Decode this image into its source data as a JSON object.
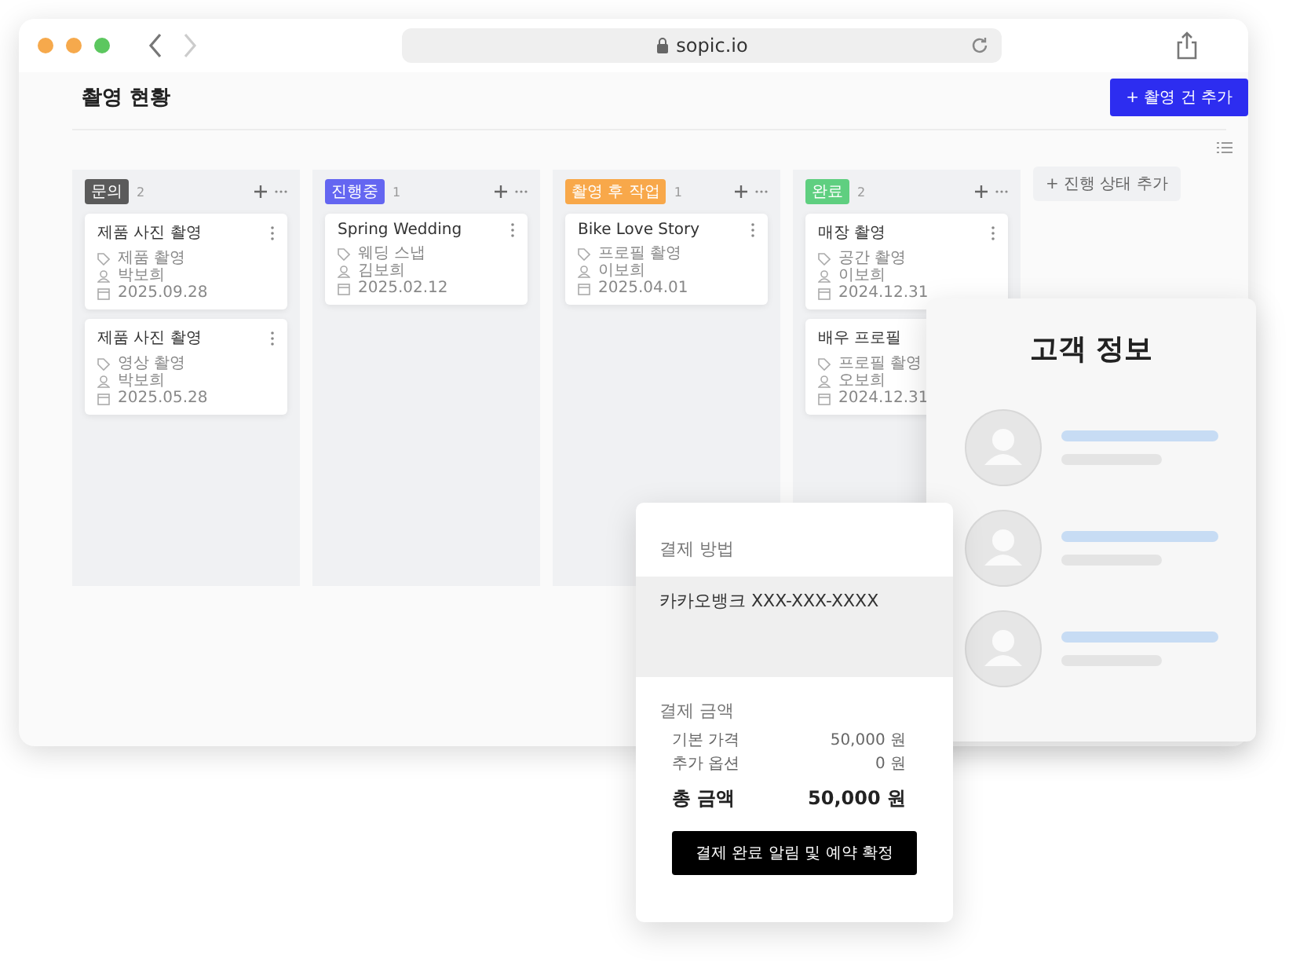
{
  "browser": {
    "url": "sopic.io"
  },
  "page": {
    "title": "촬영 현황",
    "add_button": "+ 촬영 건 추가",
    "add_status_button": "+ 진행 상태 추가"
  },
  "columns": [
    {
      "label": "문의",
      "color": "#5b5b5b",
      "count": "2",
      "cards": [
        {
          "title": "제품 사진 촬영",
          "type": "제품 촬영",
          "person": "박보희",
          "date": "2025.09.28"
        },
        {
          "title": "제품 사진 촬영",
          "type": "영상 촬영",
          "person": "박보희",
          "date": "2025.05.28"
        }
      ]
    },
    {
      "label": "진행중",
      "color": "#6466f1",
      "count": "1",
      "cards": [
        {
          "title": "Spring Wedding",
          "type": "웨딩 스냅",
          "person": "김보희",
          "date": "2025.02.12"
        }
      ]
    },
    {
      "label": "촬영 후 작업",
      "color": "#f8a84a",
      "count": "1",
      "cards": [
        {
          "title": "Bike Love Story",
          "type": "프로필 촬영",
          "person": "이보희",
          "date": "2025.04.01"
        }
      ]
    },
    {
      "label": "완료",
      "color": "#5fcf80",
      "count": "2",
      "cards": [
        {
          "title": "매장 촬영",
          "type": "공간 촬영",
          "person": "이보희",
          "date": "2024.12.31"
        },
        {
          "title": "배우 프로필",
          "type": "프로필 촬영",
          "person": "오보희",
          "date": "2024.12.31"
        }
      ]
    }
  ],
  "customer_panel": {
    "title": "고객 정보",
    "rows": [
      {
        "kind": "skeleton"
      },
      {
        "kind": "skeleton"
      },
      {
        "kind": "skeleton"
      }
    ]
  },
  "payment_panel": {
    "method_label": "결제 방법",
    "method_value": "카카오뱅크 XXX-XXX-XXXX",
    "amount_label": "결제 금액",
    "lines": [
      {
        "label": "기본 가격",
        "value": "50,000 원"
      },
      {
        "label": "추가 옵션",
        "value": "0 원"
      }
    ],
    "total": {
      "label": "총 금액",
      "value": "50,000 원"
    },
    "confirm_button": "결제 완료 알림 및 예약 확정"
  }
}
